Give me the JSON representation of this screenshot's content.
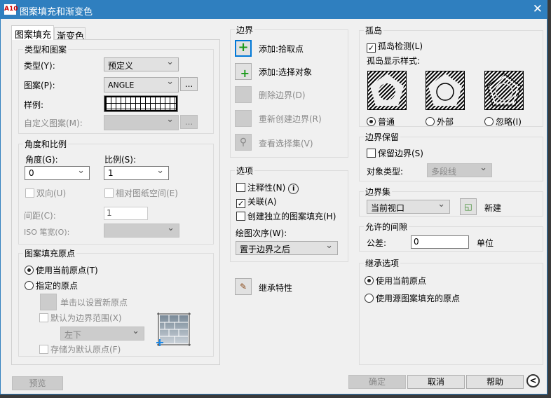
{
  "window": {
    "title": "图案填充和渐变色",
    "logo": "A10"
  },
  "tabs": [
    {
      "label": "图案填充"
    },
    {
      "label": "渐变色"
    }
  ],
  "type_pattern": {
    "title": "类型和图案",
    "type_label": "类型(Y):",
    "type_value": "预定义",
    "pattern_label": "图案(P):",
    "pattern_value": "ANGLE",
    "browse": "...",
    "sample_label": "样例:",
    "custom_label": "自定义图案(M):"
  },
  "angle_scale": {
    "title": "角度和比例",
    "angle_label": "角度(G):",
    "angle_value": "0",
    "scale_label": "比例(S):",
    "scale_value": "1",
    "double_label": "双向(U)",
    "relative_label": "相对图纸空间(E)",
    "spacing_label": "间距(C):",
    "spacing_value": "1",
    "iso_label": "ISO 笔宽(O):"
  },
  "origin": {
    "title": "图案填充原点",
    "use_current": "使用当前原点(T)",
    "specified": "指定的原点",
    "click_set": "单击以设置新原点",
    "default_extent": "默认为边界范围(X)",
    "extent_value": "左下",
    "store_default": "存储为默认原点(F)"
  },
  "boundaries": {
    "title": "边界",
    "items": [
      {
        "label": "添加:拾取点",
        "enabled": true
      },
      {
        "label": "添加:选择对象",
        "enabled": true
      },
      {
        "label": "删除边界(D)",
        "enabled": false
      },
      {
        "label": "重新创建边界(R)",
        "enabled": false
      },
      {
        "label": "查看选择集(V)",
        "enabled": false
      }
    ]
  },
  "options": {
    "title": "选项",
    "annotative": "注释性(N)",
    "associative": "关联(A)",
    "separate": "创建独立的图案填充(H)",
    "draw_order_label": "绘图次序(W):",
    "draw_order_value": "置于边界之后"
  },
  "inherit": {
    "label": "继承特性"
  },
  "islands": {
    "title": "孤岛",
    "detect": "孤岛检测(L)",
    "style_label": "孤岛显示样式:",
    "styles": [
      "普通",
      "外部",
      "忽略(I)"
    ]
  },
  "retain": {
    "title": "边界保留",
    "retain_label": "保留边界(S)",
    "object_type_label": "对象类型:",
    "object_type_value": "多段线"
  },
  "boundary_set": {
    "title": "边界集",
    "value": "当前视口",
    "new_label": "新建"
  },
  "gap": {
    "title": "允许的间隙",
    "tolerance_label": "公差:",
    "tolerance_value": "0",
    "unit": "单位"
  },
  "inherit_options": {
    "title": "继承选项",
    "use_current": "使用当前原点",
    "use_source": "使用源图案填充的原点"
  },
  "footer": {
    "preview": "预览",
    "ok": "确定",
    "cancel": "取消",
    "help": "帮助",
    "collapse": "<"
  }
}
